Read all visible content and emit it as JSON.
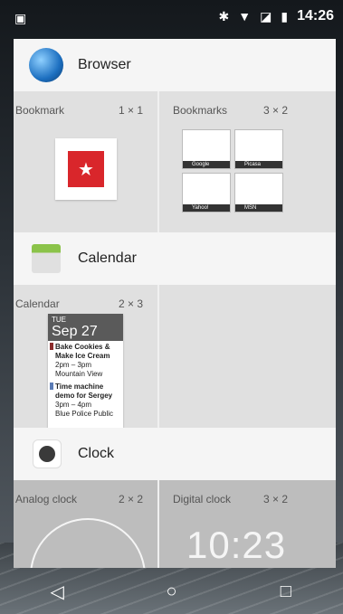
{
  "status_bar": {
    "time": "14:26",
    "icons": [
      "image-icon",
      "bluetooth-icon",
      "wifi-icon",
      "no-sim-icon",
      "battery-icon"
    ]
  },
  "apps": [
    {
      "name": "Browser",
      "icon": "globe-icon",
      "widgets": [
        {
          "label": "Bookmark",
          "size": "1 × 1"
        },
        {
          "label": "Bookmarks",
          "size": "3 × 2"
        }
      ],
      "bookmark_thumbnails": [
        "Google",
        "Picasa",
        "Yahoo!",
        "MSN"
      ]
    },
    {
      "name": "Calendar",
      "icon": "calendar-icon",
      "widgets": [
        {
          "label": "Calendar",
          "size": "2 × 3"
        }
      ],
      "calendar_preview": {
        "day_of_week": "TUE",
        "date": "Sep 27",
        "events": [
          {
            "title": "Bake Cookies & Make Ice Cream",
            "time": "2pm – 3pm",
            "location": "Mountain View",
            "color": "#8b2b2b"
          },
          {
            "title": "Time machine demo for Sergey",
            "time": "3pm – 4pm",
            "location": "Blue Police Public",
            "color": "#5a7bb5"
          }
        ]
      }
    },
    {
      "name": "Clock",
      "icon": "clock-icon",
      "widgets": [
        {
          "label": "Analog clock",
          "size": "2 × 2"
        },
        {
          "label": "Digital clock",
          "size": "3 × 2"
        }
      ],
      "digital_preview": "10:23"
    }
  ],
  "nav": {
    "back": "◁",
    "home": "○",
    "recents": "□"
  },
  "colors": {
    "accent": "#1f9b9a",
    "bookmark_red": "#d9262b"
  }
}
